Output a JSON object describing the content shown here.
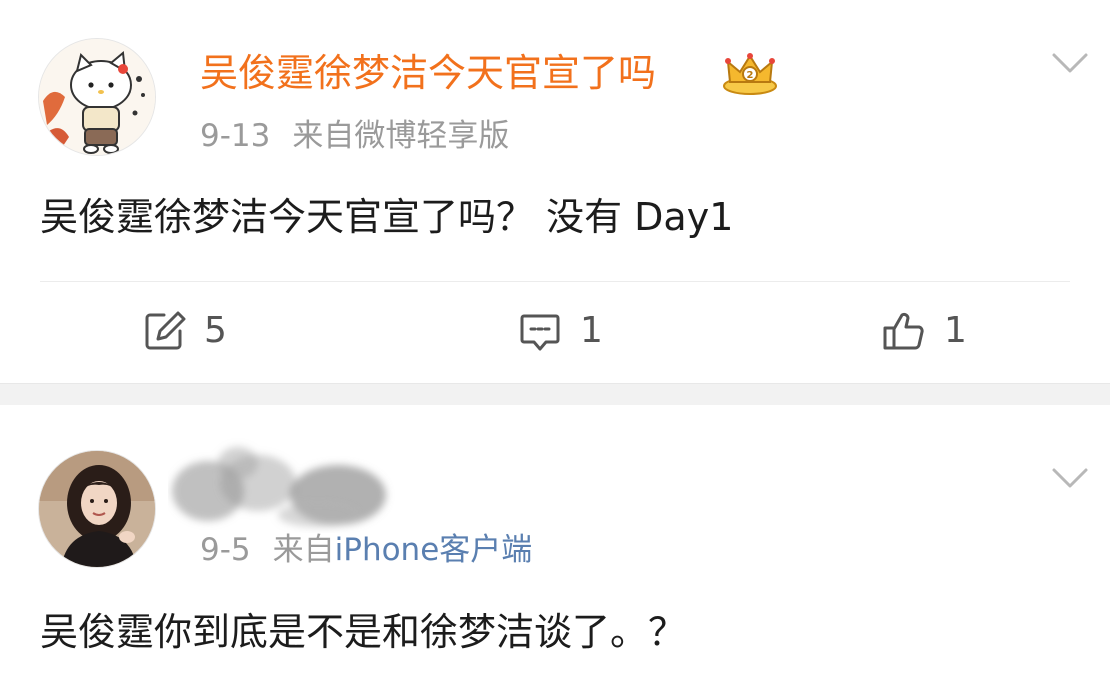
{
  "post1": {
    "username": "吴俊霆徐梦洁今天官宣了吗",
    "date": "9-13",
    "source": "来自微博轻享版",
    "text": "吴俊霆徐梦洁今天官宣了吗？ 没有 Day1",
    "actions": {
      "repost_count": "5",
      "comment_count": "1",
      "like_count": "1"
    },
    "badge_icon": "crown-badge-icon",
    "username_color": "#f2711c"
  },
  "post2": {
    "date": "9-5",
    "source_prefix": "来自",
    "source_link": "iPhone客户端",
    "text": "吴俊霆你到底是不是和徐梦洁谈了。？",
    "link_color": "#5a7fb0"
  }
}
